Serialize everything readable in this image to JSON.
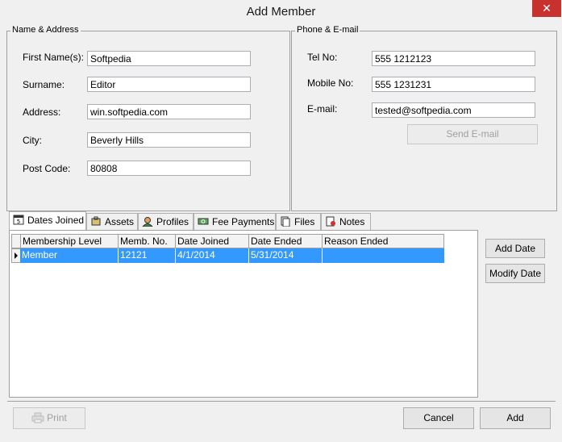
{
  "window": {
    "title": "Add Member",
    "close_glyph": "✕"
  },
  "name_address": {
    "legend": "Name & Address",
    "first_name_label": "First Name(s):",
    "first_name_value": "Softpedia",
    "surname_label": "Surname:",
    "surname_value": "Editor",
    "address_label": "Address:",
    "address_value": "win.softpedia.com",
    "city_label": "City:",
    "city_value": "Beverly Hills",
    "postcode_label": "Post Code:",
    "postcode_value": "80808"
  },
  "phone_email": {
    "legend": "Phone & E-mail",
    "tel_label": "Tel No:",
    "tel_value": "555 1212123",
    "mobile_label": "Mobile No:",
    "mobile_value": "555 1231231",
    "email_label": "E-mail:",
    "email_value": "tested@softpedia.com",
    "send_email_label": "Send E-mail"
  },
  "tabs": [
    {
      "label": "Dates Joined",
      "icon": "calendar-icon",
      "active": true
    },
    {
      "label": "Assets",
      "icon": "assets-icon",
      "active": false
    },
    {
      "label": "Profiles",
      "icon": "profile-icon",
      "active": false
    },
    {
      "label": "Fee Payments",
      "icon": "money-icon",
      "active": false
    },
    {
      "label": "Files",
      "icon": "files-icon",
      "active": false
    },
    {
      "label": "Notes",
      "icon": "notes-icon",
      "active": false
    }
  ],
  "grid": {
    "columns": [
      "Membership Level",
      "Memb. No.",
      "Date Joined",
      "Date Ended",
      "Reason Ended"
    ],
    "rows": [
      [
        "Member",
        "12121",
        "4/1/2014",
        "5/31/2014",
        ""
      ]
    ]
  },
  "side_buttons": {
    "add_date": "Add Date",
    "modify_date": "Modify Date"
  },
  "footer": {
    "print": "Print",
    "cancel": "Cancel",
    "add": "Add"
  },
  "colors": {
    "selection": "#3399ff",
    "close_button": "#c7312e"
  }
}
